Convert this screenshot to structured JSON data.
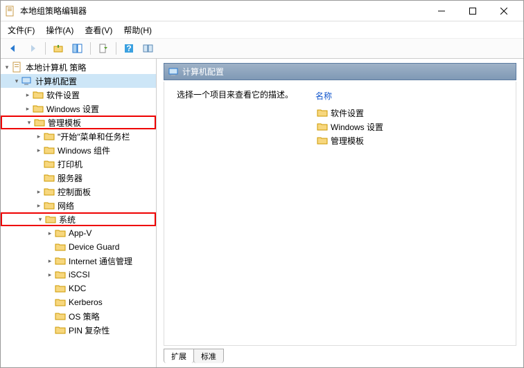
{
  "window": {
    "title": "本地组策略编辑器",
    "min": "—",
    "max": "□",
    "close": "✕"
  },
  "menu": {
    "file": "文件(F)",
    "action": "操作(A)",
    "view": "查看(V)",
    "help": "帮助(H)"
  },
  "tree": {
    "root": "本地计算机 策略",
    "computer_config": "计算机配置",
    "software_settings": "软件设置",
    "windows_settings": "Windows 设置",
    "admin_templates": "管理模板",
    "start_taskbar": "\"开始\"菜单和任务栏",
    "windows_components": "Windows 组件",
    "printers": "打印机",
    "servers": "服务器",
    "control_panel": "控制面板",
    "network": "网络",
    "system": "系统",
    "appv": "App-V",
    "device_guard": "Device Guard",
    "internet_comm": "Internet 通信管理",
    "iscsi": "iSCSI",
    "kdc": "KDC",
    "kerberos": "Kerberos",
    "os_policy": "OS 策略",
    "pin_complexity": "PIN 复杂性"
  },
  "content": {
    "path": "计算机配置",
    "desc": "选择一个项目来查看它的描述。",
    "col_name": "名称",
    "items": [
      "软件设置",
      "Windows 设置",
      "管理模板"
    ]
  },
  "tabs": {
    "extended": "扩展",
    "standard": "标准"
  }
}
